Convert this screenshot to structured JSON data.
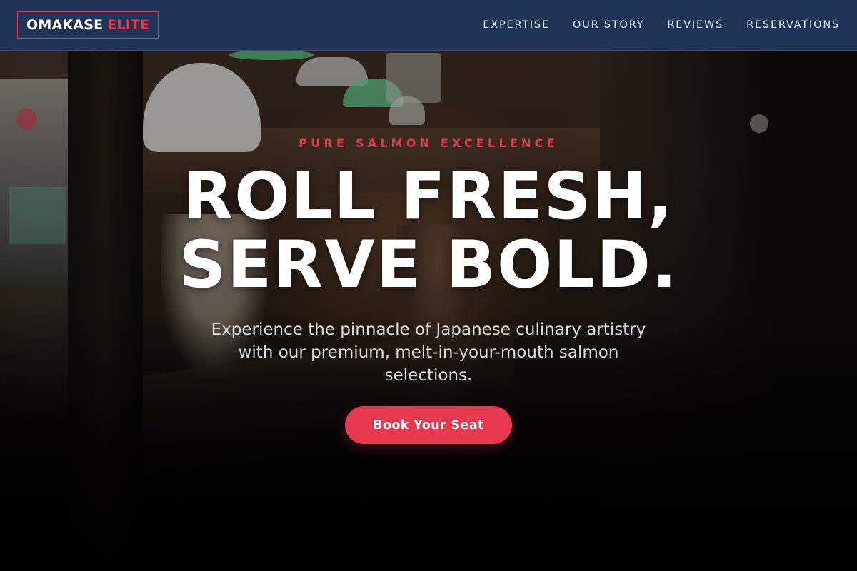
{
  "nav": {
    "logo_main": "OMAKASE",
    "logo_accent": "ELITE",
    "links": [
      {
        "label": "EXPERTISE"
      },
      {
        "label": "OUR STORY"
      },
      {
        "label": "REVIEWS"
      },
      {
        "label": "RESERVATIONS"
      }
    ]
  },
  "hero": {
    "eyebrow": "PURE SALMON EXCELLENCE",
    "headline_line1": "ROLL FRESH,",
    "headline_line2": "SERVE BOLD.",
    "subtitle": "Experience the pinnacle of Japanese culinary artistry with our premium, melt-in-your-mouth salmon selections.",
    "cta_label": "Book Your Seat",
    "background_image": "dimly lit sushi bar interior with chef and diner"
  },
  "colors": {
    "navbar_bg": "#1f3456",
    "accent": "#e6384f",
    "text_light": "#ffffff"
  }
}
